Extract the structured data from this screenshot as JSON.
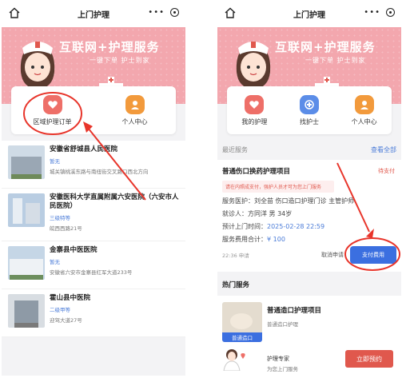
{
  "nav": {
    "title": "上门护理",
    "more": "•••"
  },
  "banner": {
    "headline": "互联网+护理服务",
    "subline": "一键下单 护士到家"
  },
  "left": {
    "cards": [
      {
        "label": "区域护理订单",
        "icon": "heart-icon"
      },
      {
        "label": "个人中心",
        "icon": "person-icon"
      }
    ],
    "hospitals": [
      {
        "name": "安徽省舒城县人民医院",
        "grade": "暂无",
        "address": "城关镇桃溪东路与南纽街交叉路口西北方向"
      },
      {
        "name": "安徽医科大学直属附属六安医院（六安市人民医院）",
        "grade": "三级特等",
        "address": "皖西西路21号"
      },
      {
        "name": "金寨县中医医院",
        "grade": "暂无",
        "address": "安徽省六安市金寨县红军大道233号"
      },
      {
        "name": "霍山县中医院",
        "grade": "二级甲等",
        "address": "迎驾大道27号"
      }
    ]
  },
  "right": {
    "cards": [
      {
        "label": "我的护理",
        "icon": "heart-icon"
      },
      {
        "label": "找护士",
        "icon": "nurse-icon"
      },
      {
        "label": "个人中心",
        "icon": "person-icon"
      }
    ],
    "recent": {
      "label": "最近服务",
      "view_all": "查看全部"
    },
    "order": {
      "title": "普通伤口换药护理项目",
      "status": "待支付",
      "warning": "请在内照成支付，强护人员才可为您上门服务",
      "service_label": "服务医护：",
      "service_value": "刘全苗 伤口造口护理门诊 主管护师",
      "patient_label": "就诊人：",
      "patient_value": "方同洋 男 34岁",
      "time_label": "预计上门时间：",
      "time_value": "2025-02-28 22:59",
      "fee_label": "服务费用合计：",
      "fee_value": "¥ 100",
      "created": "22:36 申请",
      "cancel": "取消申请",
      "pay": "支付费用"
    },
    "hot": {
      "title": "热门服务",
      "item_name": "普通造口护理项目",
      "item_desc": "普通造口护理",
      "item_tag": "普通造口",
      "expert_title": "护理专家",
      "expert_desc": "为您上门服务",
      "book": "立即预约"
    }
  },
  "colors": {
    "accent_red": "#e0584d",
    "accent_blue": "#3b6fe0",
    "banner_pink": "#f3a7ae"
  }
}
